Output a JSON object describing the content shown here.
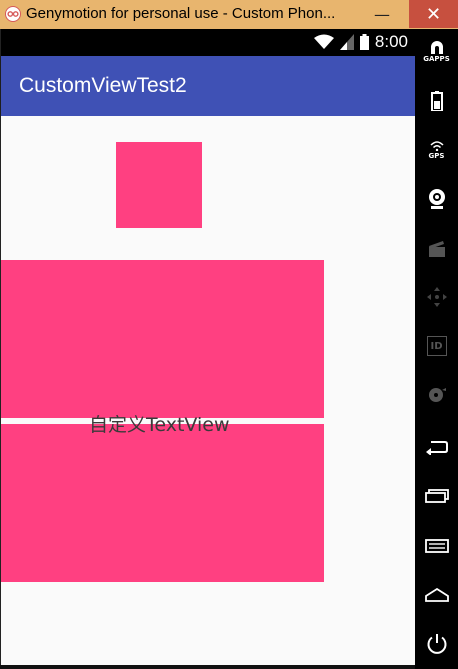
{
  "window": {
    "title": "Genymotion for personal use - Custom Phon...",
    "minimize_glyph": "—",
    "close_glyph": "✕"
  },
  "statusbar": {
    "time": "8:00"
  },
  "app": {
    "title": "CustomViewTest2"
  },
  "content": {
    "custom_text": "自定义TextView"
  },
  "sidebar": {
    "gapps_label": "GAPPS",
    "gps_label": "GPS",
    "id_label": "ID"
  },
  "colors": {
    "accent": "#ff4081",
    "primary": "#3f51b5",
    "titlebar": "#e8b56e"
  }
}
